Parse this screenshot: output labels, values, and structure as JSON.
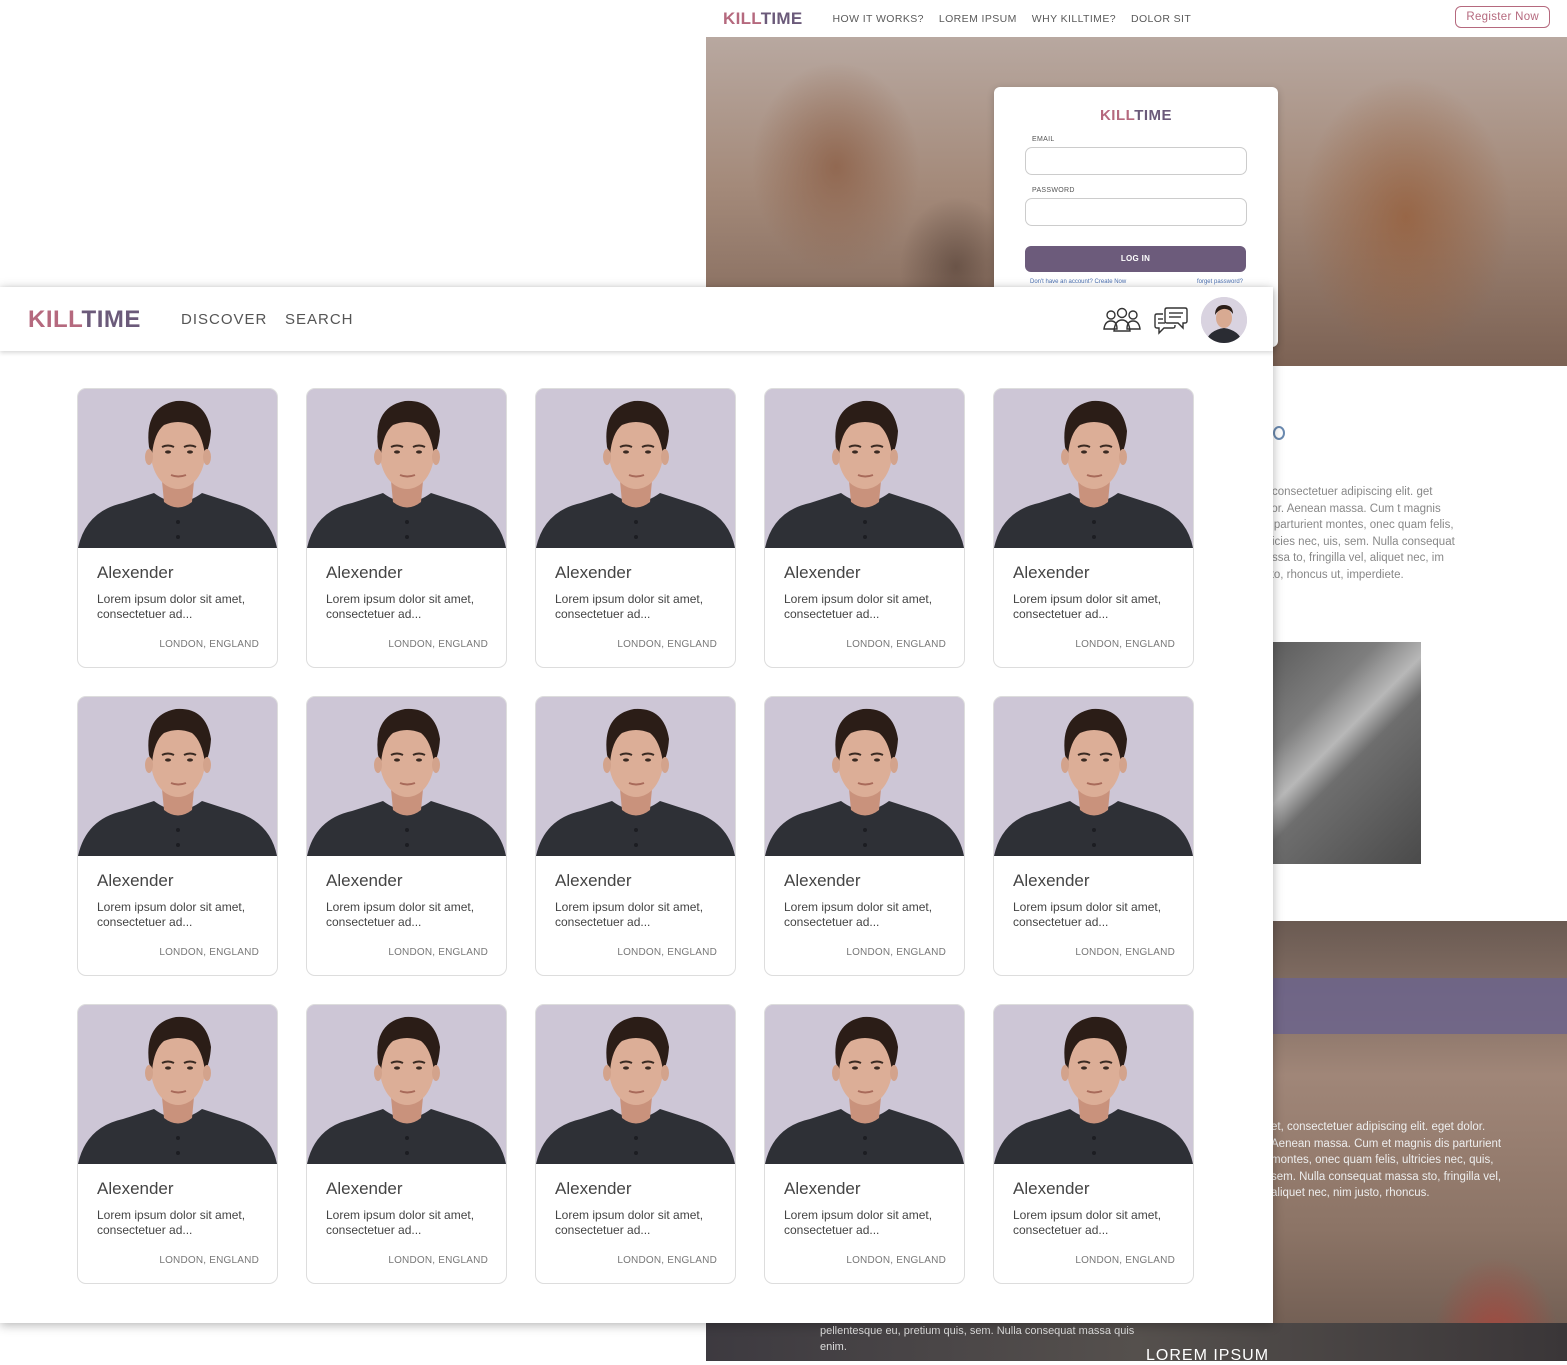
{
  "landing": {
    "logo": {
      "kill": "KILL",
      "time": "TIME"
    },
    "nav": [
      "HOW IT WORKS?",
      "LOREM IPSUM",
      "WHY KILLTIME?",
      "DOLOR SIT"
    ],
    "register_label": "Register Now",
    "login": {
      "logo": {
        "kill": "KILL",
        "time": "TIME"
      },
      "email_label": "EMAIL",
      "password_label": "PASSWORD",
      "login_button": "LOG IN",
      "create_account": "Don't have an account? Create Now",
      "forgot_password": "forget password?"
    },
    "body_text": "et, consectetuer adipiscing elit. get dolor. Aenean massa. Cum t magnis dis parturient montes, onec quam felis, ultricies nec, uis, sem. Nulla consequat massa to, fringilla vel, aliquet nec, im justo, rhoncus ut, imperdiete.",
    "section2_text": "et, consectetuer adipiscing elit. eget dolor. Aenean massa. Cum et magnis dis parturient montes, onec quam felis, ultricies nec, quis, sem. Nulla consequat massa sto, fringilla vel, aliquet nec, nim justo, rhoncus.",
    "bottom_text": "pellentesque eu, pretium quis, sem. Nulla consequat massa quis enim.",
    "bottom_heading": "LOREM IPSUM"
  },
  "app": {
    "logo": {
      "kill": "KILL",
      "time": "TIME"
    },
    "nav": {
      "discover": "DISCOVER",
      "search": "SEARCH"
    },
    "icons": {
      "group": "group-icon",
      "chat": "chat-icon",
      "avatar": "avatar"
    },
    "accent_colors": {
      "kill": "#b5697e",
      "time": "#6b5a7a",
      "button": "#6c5b7b"
    },
    "profiles": [
      {
        "name": "Alexender",
        "desc": "Lorem ipsum dolor sit amet, consectetuer ad...",
        "location": "LONDON, ENGLAND"
      },
      {
        "name": "Alexender",
        "desc": "Lorem ipsum dolor sit amet, consectetuer ad...",
        "location": "LONDON, ENGLAND"
      },
      {
        "name": "Alexender",
        "desc": "Lorem ipsum dolor sit amet, consectetuer ad...",
        "location": "LONDON, ENGLAND"
      },
      {
        "name": "Alexender",
        "desc": "Lorem ipsum dolor sit amet, consectetuer ad...",
        "location": "LONDON, ENGLAND"
      },
      {
        "name": "Alexender",
        "desc": "Lorem ipsum dolor sit amet, consectetuer ad...",
        "location": "LONDON, ENGLAND"
      },
      {
        "name": "Alexender",
        "desc": "Lorem ipsum dolor sit amet, consectetuer ad...",
        "location": "LONDON, ENGLAND"
      },
      {
        "name": "Alexender",
        "desc": "Lorem ipsum dolor sit amet, consectetuer ad...",
        "location": "LONDON, ENGLAND"
      },
      {
        "name": "Alexender",
        "desc": "Lorem ipsum dolor sit amet, consectetuer ad...",
        "location": "LONDON, ENGLAND"
      },
      {
        "name": "Alexender",
        "desc": "Lorem ipsum dolor sit amet, consectetuer ad...",
        "location": "LONDON, ENGLAND"
      },
      {
        "name": "Alexender",
        "desc": "Lorem ipsum dolor sit amet, consectetuer ad...",
        "location": "LONDON, ENGLAND"
      },
      {
        "name": "Alexender",
        "desc": "Lorem ipsum dolor sit amet, consectetuer ad...",
        "location": "LONDON, ENGLAND"
      },
      {
        "name": "Alexender",
        "desc": "Lorem ipsum dolor sit amet, consectetuer ad...",
        "location": "LONDON, ENGLAND"
      },
      {
        "name": "Alexender",
        "desc": "Lorem ipsum dolor sit amet, consectetuer ad...",
        "location": "LONDON, ENGLAND"
      },
      {
        "name": "Alexender",
        "desc": "Lorem ipsum dolor sit amet, consectetuer ad...",
        "location": "LONDON, ENGLAND"
      },
      {
        "name": "Alexender",
        "desc": "Lorem ipsum dolor sit amet, consectetuer ad...",
        "location": "LONDON, ENGLAND"
      }
    ]
  }
}
